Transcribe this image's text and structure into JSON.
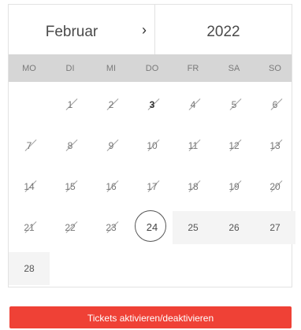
{
  "header": {
    "month": "Februar",
    "next_glyph": "›",
    "year": "2022"
  },
  "weekdays": [
    "MO",
    "DI",
    "MI",
    "DO",
    "FR",
    "SA",
    "SO"
  ],
  "days": {
    "d1": "1",
    "d2": "2",
    "d3": "3",
    "d4": "4",
    "d5": "5",
    "d6": "6",
    "d7": "7",
    "d8": "8",
    "d9": "9",
    "d10": "10",
    "d11": "11",
    "d12": "12",
    "d13": "13",
    "d14": "14",
    "d15": "15",
    "d16": "16",
    "d17": "17",
    "d18": "18",
    "d19": "19",
    "d20": "20",
    "d21": "21",
    "d22": "22",
    "d23": "23",
    "d24": "24",
    "d25": "25",
    "d26": "26",
    "d27": "27",
    "d28": "28"
  },
  "selected_day": "24",
  "today": "3",
  "action": {
    "label": "Tickets aktivieren/deaktivieren"
  },
  "colors": {
    "accent": "#ef4136",
    "weekday_bar": "#d6d6d6",
    "available_cell": "#f4f4f4"
  },
  "icons": {
    "next": "chevron-right-icon"
  }
}
